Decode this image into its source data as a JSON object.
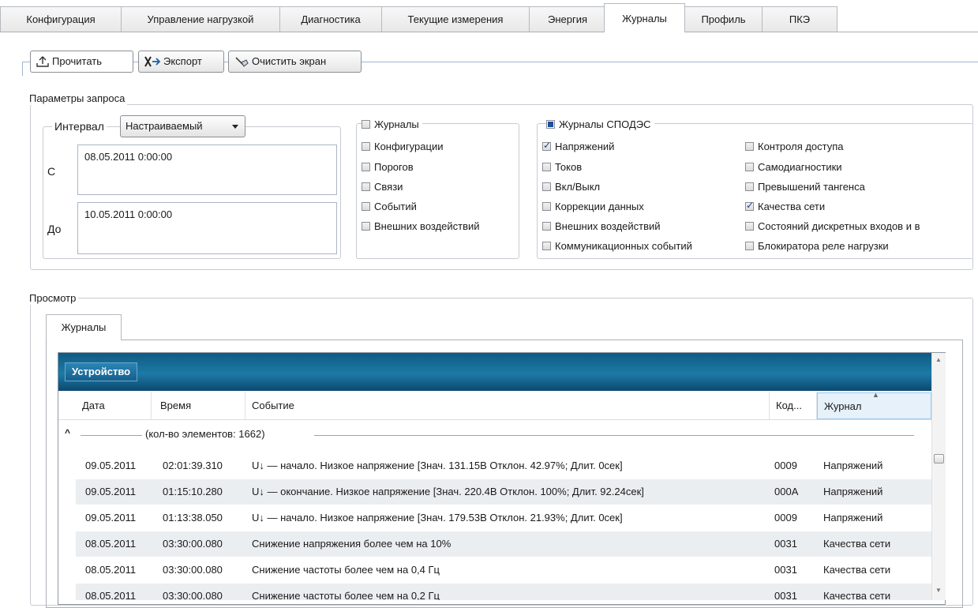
{
  "tabs": [
    "Конфигурация",
    "Управление нагрузкой",
    "Диагностика",
    "Текущие измерения",
    "Энергия",
    "Журналы",
    "Профиль",
    "ПКЭ"
  ],
  "toolbar": {
    "read": "Прочитать",
    "export": "Экспорт",
    "clear": "Очистить экран"
  },
  "query": {
    "title": "Параметры запроса",
    "interval_label": "Интервал",
    "interval_value": "Настраиваемый",
    "from_label": "С",
    "from_value": "08.05.2011 0:00:00",
    "to_label": "До",
    "to_value": "10.05.2011 0:00:00"
  },
  "journals": {
    "title": "Журналы",
    "items": [
      "Конфигурации",
      "Порогов",
      "Связи",
      "Событий",
      "Внешних воздействий"
    ]
  },
  "spodes": {
    "title": "Журналы СПОДЭС",
    "col1": [
      {
        "label": "Напряжений",
        "checked": true
      },
      {
        "label": "Токов",
        "checked": false
      },
      {
        "label": "Вкл/Выкл",
        "checked": false
      },
      {
        "label": "Коррекции данных",
        "checked": false
      },
      {
        "label": "Внешних воздействий",
        "checked": false
      },
      {
        "label": "Коммуникационных событий",
        "checked": false
      }
    ],
    "col2": [
      {
        "label": "Контроля доступа",
        "checked": false
      },
      {
        "label": "Самодиагностики",
        "checked": false
      },
      {
        "label": "Превышений тангенса",
        "checked": false
      },
      {
        "label": "Качества сети",
        "checked": true
      },
      {
        "label": "Состояний дискретных входов и в",
        "checked": false
      },
      {
        "label": "Блокиратора реле нагрузки",
        "checked": false
      }
    ]
  },
  "view": {
    "title": "Просмотр",
    "tab": "Журналы",
    "device": "Устройство",
    "columns": [
      "Дата",
      "Время",
      "Событие",
      "Код...",
      "Журнал"
    ],
    "group": "(кол-во элементов: 1662)",
    "rows": [
      [
        "09.05.2011",
        "02:01:39.310",
        "U↓ — начало. Низкое напряжение [Знач. 131.15В Отклон. 42.97%; Длит. 0сек]",
        "0009",
        "Напряжений"
      ],
      [
        "09.05.2011",
        "01:15:10.280",
        "U↓ — окончание. Низкое напряжение [Знач. 220.4В Отклон. 100%; Длит. 92.24сек]",
        "000A",
        "Напряжений"
      ],
      [
        "09.05.2011",
        "01:13:38.050",
        "U↓ — начало. Низкое напряжение [Знач. 179.53В Отклон. 21.93%; Длит. 0сек]",
        "0009",
        "Напряжений"
      ],
      [
        "08.05.2011",
        "03:30:00.080",
        "Снижение напряжения более чем на 10%",
        "0031",
        "Качества сети"
      ],
      [
        "08.05.2011",
        "03:30:00.080",
        "Снижение частоты более чем на 0,4 Гц",
        "0031",
        "Качества сети"
      ],
      [
        "08.05.2011",
        "03:30:00.080",
        "Снижение частоты более чем на 0,2 Гц",
        "0031",
        "Качества сети"
      ]
    ]
  }
}
